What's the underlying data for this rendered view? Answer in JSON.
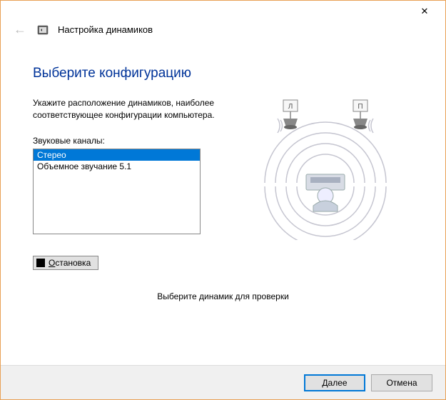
{
  "header": {
    "title": "Настройка динамиков"
  },
  "main": {
    "heading": "Выберите конфигурацию",
    "description_line1": "Укажите расположение динамиков, наиболее",
    "description_line2": "соответствующее конфигурации компьютера.",
    "list_label": "Звуковые каналы:",
    "channels": [
      {
        "label": "Стерео",
        "selected": true
      },
      {
        "label": "Объемное звучание 5.1",
        "selected": false
      }
    ],
    "stop_button": "Остановка",
    "hint": "Выберите динамик для проверки"
  },
  "illustration": {
    "left_speaker": "Л",
    "right_speaker": "П"
  },
  "footer": {
    "next": "Далее",
    "cancel": "Отмена"
  }
}
